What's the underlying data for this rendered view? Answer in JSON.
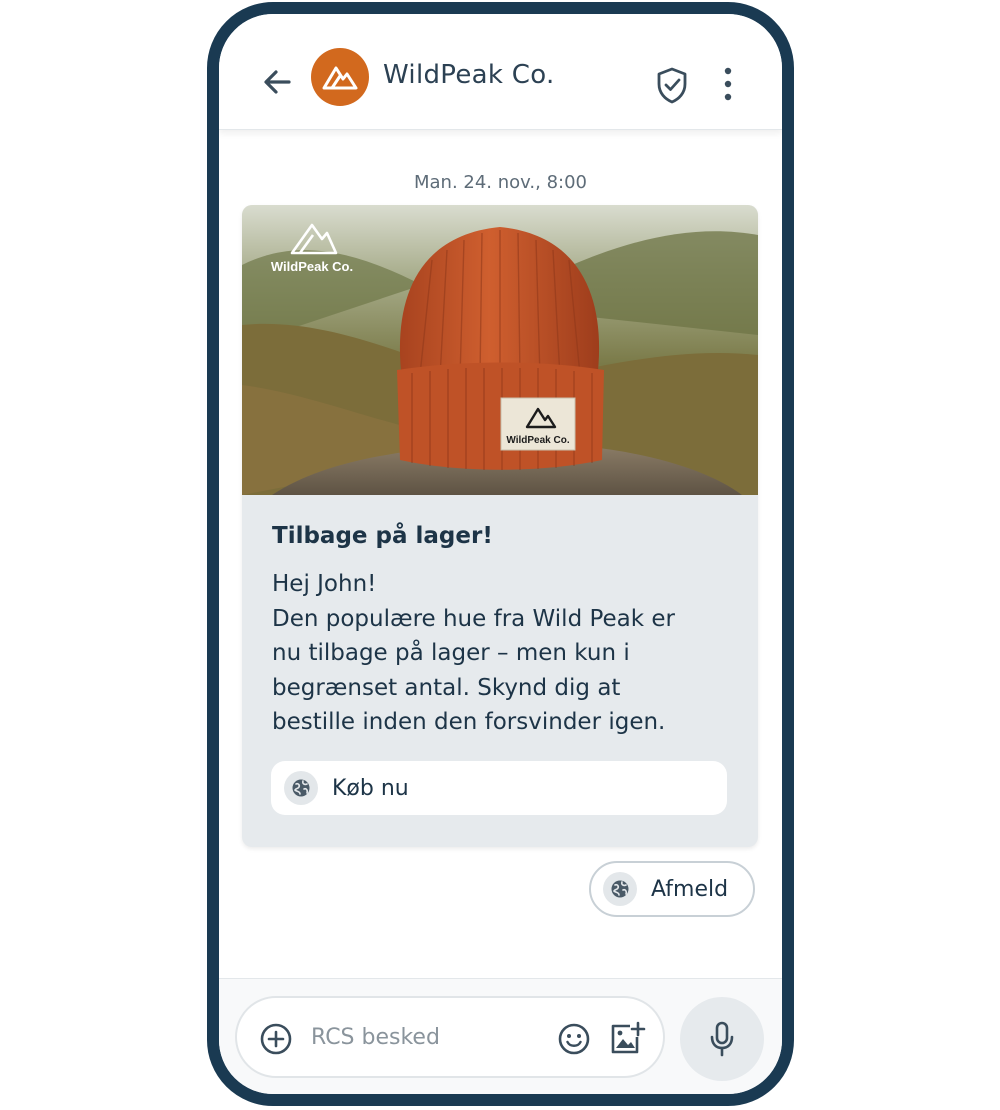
{
  "header": {
    "title": "WildPeak Co.",
    "icons": {
      "back": "arrow-left-icon",
      "avatar": "mountain-logo-icon",
      "verified": "shield-check-icon",
      "menu": "more-vert-icon"
    },
    "avatar_color": "#d2691e"
  },
  "conversation": {
    "timestamp": "Man. 24. nov., 8:00"
  },
  "card": {
    "image": {
      "brand_logo_text": "WildPeak Co.",
      "label_text": "WildPeak Co."
    },
    "title": "Tilbage på lager!",
    "body_lines": [
      "Hej John!",
      "Den populære hue fra Wild Peak er",
      "nu tilbage på lager – men kun i",
      "begrænset antal. Skynd dig at",
      "bestille inden den forsvinder igen."
    ],
    "action": {
      "label": "Køb nu",
      "icon": "globe-icon"
    }
  },
  "suggestion": {
    "label": "Afmeld",
    "icon": "globe-icon"
  },
  "composer": {
    "placeholder": "RCS besked",
    "icons": {
      "add": "add-circle-icon",
      "emoji": "emoji-icon",
      "attach_image": "add-photo-icon",
      "mic": "mic-icon"
    }
  },
  "colors": {
    "frame": "#1a3a52",
    "text": "#1d3447",
    "card_bg": "#e6eaed",
    "beanie": "#c4552a"
  }
}
